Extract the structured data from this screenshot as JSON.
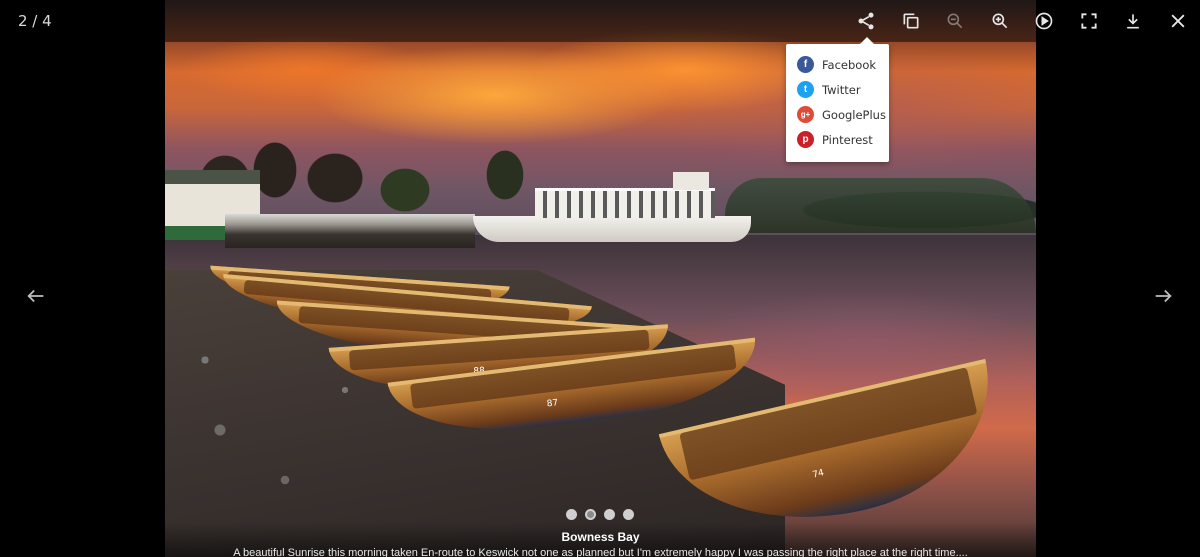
{
  "counter": "2 / 4",
  "toolbar": {
    "buttons": [
      {
        "name": "share",
        "icon": "share-icon"
      },
      {
        "name": "thumbnails",
        "icon": "copy-icon"
      },
      {
        "name": "zoom-out",
        "icon": "zoom-out-icon",
        "disabled": true
      },
      {
        "name": "zoom-in",
        "icon": "zoom-in-icon"
      },
      {
        "name": "autoplay",
        "icon": "play-icon"
      },
      {
        "name": "fullscreen",
        "icon": "fullscreen-icon"
      },
      {
        "name": "download",
        "icon": "download-icon"
      },
      {
        "name": "close",
        "icon": "close-icon"
      }
    ]
  },
  "share_menu": {
    "items": [
      {
        "label": "Facebook",
        "icon": "facebook-icon",
        "glyph": "f",
        "color": "#3b5998"
      },
      {
        "label": "Twitter",
        "icon": "twitter-icon",
        "glyph": "t",
        "color": "#1da1f2"
      },
      {
        "label": "GooglePlus",
        "icon": "googleplus-icon",
        "glyph": "g+",
        "color": "#dd4b39"
      },
      {
        "label": "Pinterest",
        "icon": "pinterest-icon",
        "glyph": "p",
        "color": "#cb2027"
      }
    ]
  },
  "photo": {
    "boat_numbers": [
      "88",
      "87",
      "74"
    ]
  },
  "pager": {
    "count": 4,
    "active_index": 1
  },
  "caption": {
    "title": "Bowness Bay",
    "text": "A beautiful Sunrise this morning taken En-route to Keswick not one as planned but I'm extremely happy I was passing the right place at the right time...."
  },
  "colors": {
    "icon": "#e6e6e6",
    "background": "#000000"
  }
}
